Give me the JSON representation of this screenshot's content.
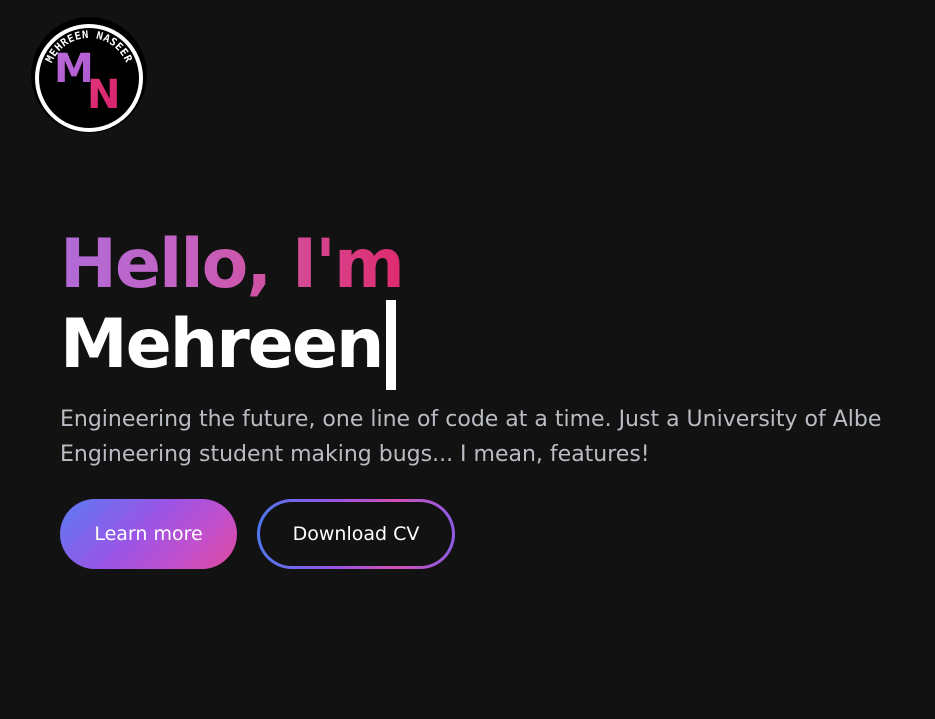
{
  "logo": {
    "initials_first": "M",
    "initials_second": "N",
    "ring_text": "MEHREEN NASEER"
  },
  "hero": {
    "greeting": "Hello, I'm",
    "name": "Mehreen",
    "tagline_line1": "Engineering the future, one line of code at a time. Just a University of Albe",
    "tagline_line2": "Engineering student making bugs... I mean, features!"
  },
  "actions": {
    "learn_more_label": "Learn more",
    "download_cv_label": "Download CV"
  },
  "colors": {
    "background": "#121212",
    "gradient_start": "#b06ad8",
    "gradient_end": "#e02a6e",
    "button_gradient_start": "#5a7bf3",
    "button_gradient_end": "#de4a9b",
    "tagline": "#b9bcc2"
  }
}
